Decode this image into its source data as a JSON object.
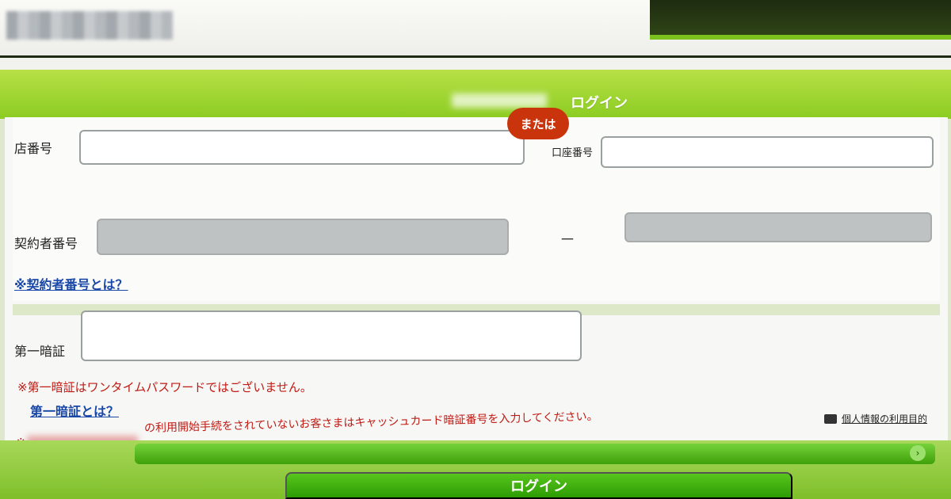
{
  "header": {
    "band_title": "ログイン"
  },
  "form": {
    "store_number": {
      "label": "店番号",
      "value": ""
    },
    "account_number": {
      "label": "口座番号",
      "value": ""
    },
    "or_badge": "または",
    "contract_number": {
      "label": "契約者番号",
      "separator": "－",
      "value1": "",
      "value2": ""
    },
    "contract_help_link": "※契約者番号とは？",
    "first_pin": {
      "label": "第一暗証",
      "value": ""
    },
    "warning_1": "※第一暗証はワンタイムパスワードではございません。",
    "first_pin_help_link": "第一暗証とは？",
    "warning_2_prefix": "※",
    "warning_2_text": "の利用開始手続をされていないお客さまはキャッシュカード暗証番号を入力してください。",
    "privacy_link": "個人情報の利用目的"
  },
  "buttons": {
    "next_icon": "›",
    "login": "ログイン"
  },
  "colors": {
    "accent_green": "#8ccc22",
    "or_badge_red": "#c9340c",
    "warning_red": "#c01a14",
    "link_blue": "#1a48a8"
  }
}
